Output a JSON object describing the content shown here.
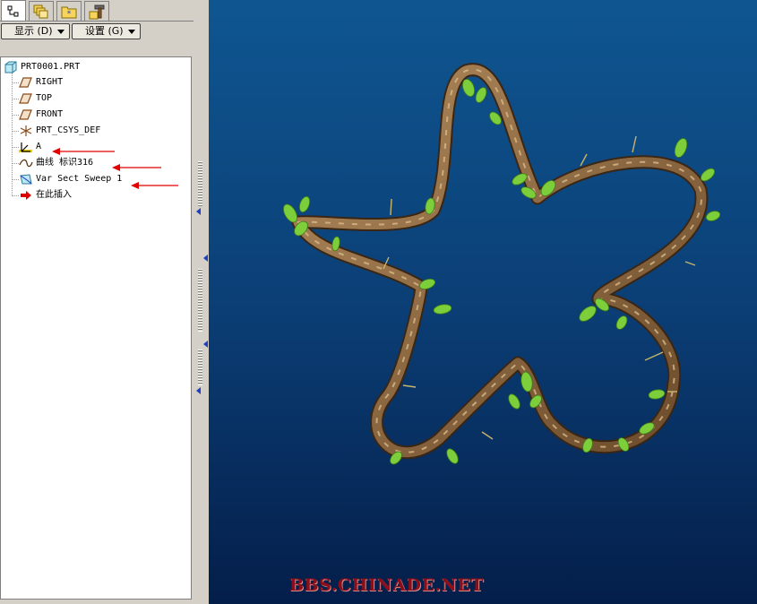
{
  "tabs": [
    {
      "icon": "model-tree-icon",
      "active": true
    },
    {
      "icon": "layers-icon",
      "active": false
    },
    {
      "icon": "favorites-icon",
      "active": false
    },
    {
      "icon": "tools-icon",
      "active": false
    }
  ],
  "toolbar": {
    "show_label": "显示 (D)",
    "settings_label": "设置 (G)"
  },
  "tree": {
    "root": "PRT0001.PRT",
    "items": [
      {
        "label": "RIGHT",
        "icon": "datum-plane-icon"
      },
      {
        "label": "TOP",
        "icon": "datum-plane-icon"
      },
      {
        "label": "FRONT",
        "icon": "datum-plane-icon"
      },
      {
        "label": "PRT_CSYS_DEF",
        "icon": "coordinate-system-icon"
      },
      {
        "label": "A",
        "icon": "axis-csys-icon"
      },
      {
        "label": "曲线 标识316",
        "icon": "curve-icon"
      },
      {
        "label": "Var Sect Sweep 1",
        "icon": "sweep-feature-icon"
      },
      {
        "label": "在此插入",
        "icon": "insert-here-arrow-icon"
      }
    ]
  },
  "viewport": {
    "watermark": "BBS.CHINADE.NET"
  },
  "colors": {
    "annotation_arrow": "#e00000",
    "background_top": "#0f5691",
    "background_bottom": "#041e4a",
    "vine": "#8a6840",
    "leaf": "#7ccf3a"
  }
}
